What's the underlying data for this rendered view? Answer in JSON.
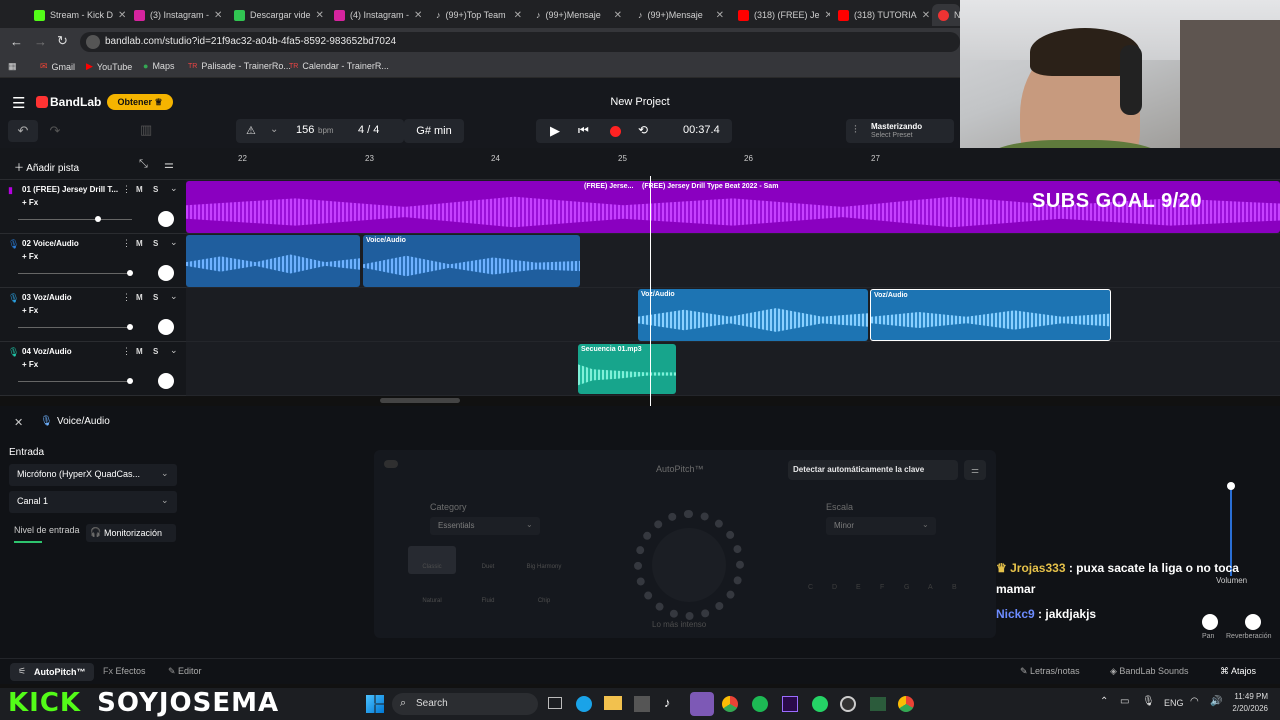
{
  "browser": {
    "tabs": [
      {
        "label": "Stream - Kick D",
        "color": "#53fc18"
      },
      {
        "label": "(3) Instagram -",
        "color": "#d6249f"
      },
      {
        "label": "Descargar vide",
        "color": "#31c552"
      },
      {
        "label": "(4) Instagram -",
        "color": "#d6249f"
      },
      {
        "label": "(99+)Top Team",
        "color": "#111111"
      },
      {
        "label": "(99+)Mensaje",
        "color": "#111111"
      },
      {
        "label": "(99+)Mensaje",
        "color": "#111111"
      },
      {
        "label": "(318) (FREE) Je",
        "color": "#ff0000"
      },
      {
        "label": "(318) TUTORIA",
        "color": "#ff0000"
      },
      {
        "label": "N",
        "color": "#e33"
      }
    ],
    "url": "bandlab.com/studio?id=21f9ac32-a04b-4fa5-8592-983652bd7024",
    "bookmarks": [
      "Gmail",
      "YouTube",
      "Maps",
      "Palisade - TrainerRo...",
      "Calendar - TrainerR..."
    ]
  },
  "app": {
    "logo": "BandLab",
    "obtener": "Obtener",
    "project_title": "New Project",
    "bpm": "156",
    "bpm_unit": "bpm",
    "time_sig": "4 / 4",
    "key": "G# min",
    "time": "00:37.4",
    "mastering_title": "Masterizando",
    "mastering_sub": "Select Preset",
    "add_track": "Añadir pista"
  },
  "ruler": [
    "22",
    "23",
    "24",
    "25",
    "26",
    "27"
  ],
  "tracks": [
    {
      "name": "01  (FREE) Jersey Drill T...",
      "fx": "+ Fx",
      "color": "#b400e0"
    },
    {
      "name": "02  Voice/Audio",
      "fx": "+ Fx",
      "color": "#2a7bd6"
    },
    {
      "name": "03  Voz/Audio",
      "fx": "+ Fx",
      "color": "#2aa0e0"
    },
    {
      "name": "04  Voz/Audio",
      "fx": "+ Fx",
      "color": "#1fc6a8"
    }
  ],
  "track_btns": {
    "m": "M",
    "s": "S"
  },
  "clips": {
    "c1a": "(FREE) Jerse...",
    "c1b": "(FREE) Jersey Drill Type Beat 2022 - Sam",
    "c2": "Voice/Audio",
    "c3a": "Voz/Audio",
    "c3b": "Voz/Audio",
    "c4": "Secuencia 01.mp3"
  },
  "overlay": {
    "subs": "SUBS GOAL 9/20"
  },
  "panel": {
    "track": "Voice/Audio",
    "entrada": "Entrada",
    "mic": "Micrófono (HyperX QuadCas...",
    "canal": "Canal 1",
    "nivel": "Nivel de entrada",
    "monitor": "Monitorización",
    "autopitch": "AutoPitch™",
    "detect": "Detectar automáticamente la clave",
    "category": "Category",
    "category_val": "Essentials",
    "escala": "Escala",
    "escala_val": "Minor",
    "presets": [
      "Classic",
      "Duet",
      "Big Harmony",
      "Natural",
      "Fluid",
      "Chip"
    ],
    "mas_intenso": "Lo más intenso",
    "notes": [
      "C",
      "D",
      "E",
      "F",
      "G",
      "A",
      "B"
    ],
    "volumen": "Volumen",
    "pan": "Pan",
    "reverb": "Reverberación"
  },
  "chat": [
    {
      "user": "Jrojas333",
      "msg": ": puxa sacate la liga o no toca mamar",
      "color": "#e5c14a"
    },
    {
      "user": "Nickc9",
      "msg": ": jakdjakjs",
      "color": "#6d8cff"
    }
  ],
  "status": {
    "autopitch": "AutoPitch™",
    "efectos": "Efectos",
    "editor": "Editor",
    "letras": "Letras/notas",
    "sounds": "BandLab Sounds",
    "atajos": "Atajos"
  },
  "brand_left": "KICK",
  "brand_right": "SOYJOSEMA",
  "taskbar": {
    "search": "Search",
    "lang": "ENG",
    "time": "11:49 PM",
    "date": "2/20/2026"
  }
}
